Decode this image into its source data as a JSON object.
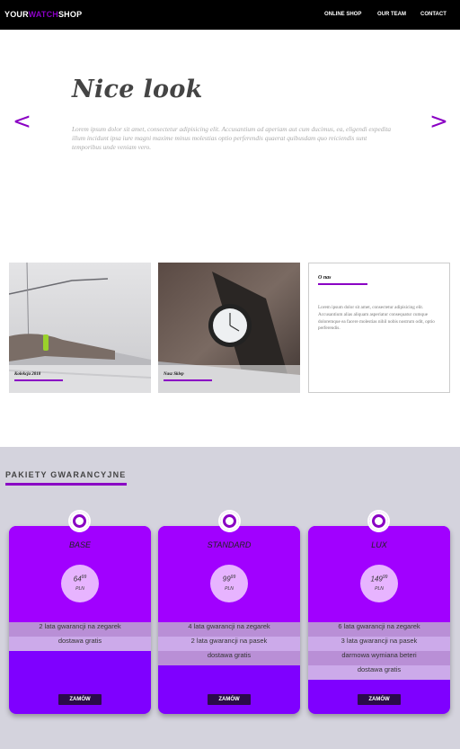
{
  "header": {
    "logo": {
      "part1": "YOUR",
      "part2": "WATCH",
      "part3": "SHOP"
    },
    "nav": [
      "ONLINE SHOP",
      "OUR TEAM",
      "CONTACT"
    ]
  },
  "hero": {
    "title": "Nice look",
    "text": "Lorem ipsum dolor sit amet, consectetur adipisicing elit. Accusantium ad aperiam aut cum ducimus, ea, eligendi expedita illum incidunt ipsa iure magni maxime minus molestias optio perferendis quaerat quibusdam quo reiciendis sunt temporibus unde veniam vero.",
    "prev": "<",
    "next": ">"
  },
  "gallery": {
    "cards": [
      {
        "caption": "Kolekcja 2018"
      },
      {
        "caption": "Nasz Sklep"
      }
    ],
    "about": {
      "title": "O nas",
      "text": "Lorem ipsum dolor sit amet, consectetur adipisicing elit. Accusantium alias aliquam asperiatur consequatur cumque doloremque ea facere molestias nihil nobis nostrum odit, optio perferendis."
    }
  },
  "pricing": {
    "title": "PAKIETY GWARANCYJNE",
    "plans": [
      {
        "name": "BASE",
        "price": "64",
        "cents": "99",
        "currency": "PLN",
        "features": [
          "2 lata gwarancji na zegarek",
          "dostawa gratis"
        ],
        "button": "ZAMÓW"
      },
      {
        "name": "STANDARD",
        "price": "99",
        "cents": "99",
        "currency": "PLN",
        "features": [
          "4 lata gwarancji na zegarek",
          "2 lata gwarancji na pasek",
          "dostawa gratis"
        ],
        "button": "ZAMÓW"
      },
      {
        "name": "LUX",
        "price": "149",
        "cents": "99",
        "currency": "PLN",
        "features": [
          "6 lata gwarancji na zegarek",
          "3 lata gwarancji na pasek",
          "darmowa wymiana beteri",
          "dostawa gratis"
        ],
        "button": "ZAMÓW"
      }
    ]
  },
  "colors": {
    "accent": "#8a00c4",
    "plan_bg": "#7f00ff",
    "plan_top": "#a100ff",
    "pricing_bg": "#d4d3dd"
  }
}
